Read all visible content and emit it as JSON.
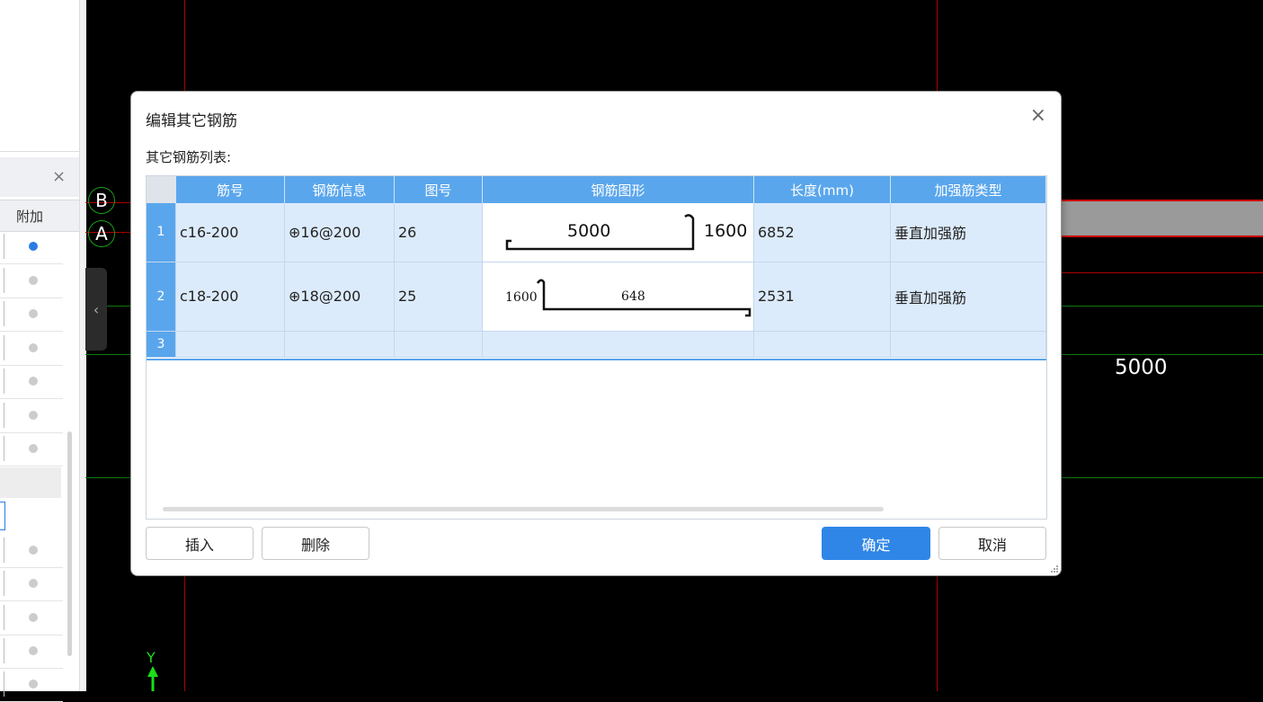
{
  "left_panel": {
    "column_header": "附加",
    "radio_rows": [
      {
        "checked": true
      },
      {
        "checked": false
      },
      {
        "checked": false
      },
      {
        "checked": false
      },
      {
        "checked": false
      },
      {
        "checked": false
      },
      {
        "checked": false
      },
      {
        "checked": false
      },
      {
        "checked": false
      },
      {
        "checked": false
      },
      {
        "checked": false
      },
      {
        "checked": false
      }
    ],
    "close_icon": "×",
    "collapse_icon": "‹"
  },
  "canvas": {
    "axis_labels": [
      "B",
      "A"
    ],
    "dimension_label": "5000",
    "y_axis_label": "Y"
  },
  "dialog": {
    "title": "编辑其它钢筋",
    "close_icon": "×",
    "list_label": "其它钢筋列表:",
    "columns": [
      "筋号",
      "钢筋信息",
      "图号",
      "钢筋图形",
      "长度(mm)",
      "加强筋类型"
    ],
    "rows": [
      {
        "num": "1",
        "bar_no": "c16-200",
        "bar_info": "⊕16@200",
        "figure_no": "26",
        "shape_dims": [
          "5000",
          "1600"
        ],
        "length": "6852",
        "type": "垂直加强筋"
      },
      {
        "num": "2",
        "bar_no": "c18-200",
        "bar_info": "⊕18@200",
        "figure_no": "25",
        "shape_dims": [
          "1600",
          "648"
        ],
        "length": "2531",
        "type": "垂直加强筋"
      },
      {
        "num": "3",
        "bar_no": "",
        "bar_info": "",
        "figure_no": "",
        "shape_dims": [],
        "length": "",
        "type": ""
      }
    ],
    "buttons": {
      "insert": "插入",
      "delete": "删除",
      "ok": "确定",
      "cancel": "取消"
    }
  }
}
